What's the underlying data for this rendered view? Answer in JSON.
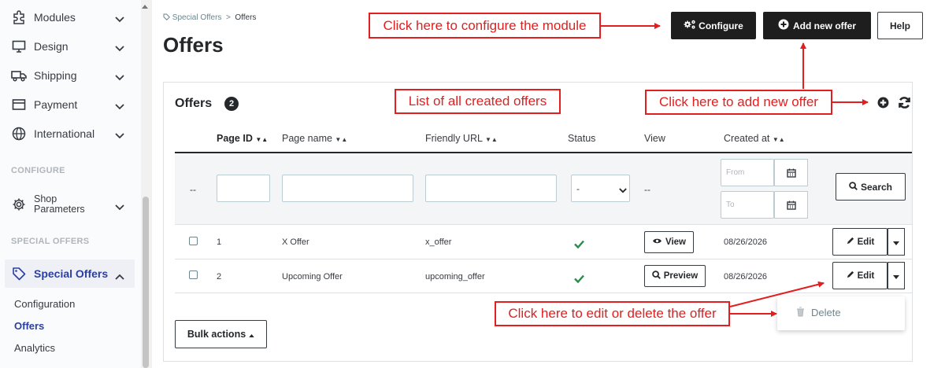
{
  "sidebar": {
    "items": [
      {
        "label": "Modules",
        "icon": "puzzle-icon"
      },
      {
        "label": "Design",
        "icon": "monitor-icon"
      },
      {
        "label": "Shipping",
        "icon": "truck-icon"
      },
      {
        "label": "Payment",
        "icon": "card-icon"
      },
      {
        "label": "International",
        "icon": "globe-icon"
      }
    ],
    "section_configure": "CONFIGURE",
    "shop_parameters_line1": "Shop",
    "shop_parameters_line2": "Parameters",
    "section_special": "SPECIAL OFFERS",
    "special_offers_label": "Special Offers",
    "sub_items": [
      "Configuration",
      "Offers",
      "Analytics"
    ]
  },
  "header": {
    "breadcrumb_parent": "Special Offers",
    "breadcrumb_sep": ">",
    "breadcrumb_current": "Offers",
    "title": "Offers",
    "configure_label": "Configure",
    "add_offer_label": "Add new offer",
    "help_label": "Help"
  },
  "card": {
    "title": "Offers",
    "count": "2",
    "columns": {
      "page_id": "Page ID",
      "page_name": "Page name",
      "friendly_url": "Friendly URL",
      "status": "Status",
      "view": "View",
      "created_at": "Created at"
    },
    "filters": {
      "dash1": "--",
      "status_select": "-",
      "dash2": "--",
      "from_placeholder": "From",
      "to_placeholder": "To",
      "search_label": "Search"
    },
    "rows": [
      {
        "id": "1",
        "name": "X Offer",
        "url": "x_offer",
        "view_label": "View",
        "date": "08/26/2026",
        "edit_label": "Edit"
      },
      {
        "id": "2",
        "name": "Upcoming Offer",
        "url": "upcoming_offer",
        "view_label": "Preview",
        "date": "08/26/2026",
        "edit_label": "Edit"
      }
    ],
    "delete_label": "Delete",
    "bulk_actions_label": "Bulk actions"
  },
  "annotations": {
    "configure": "Click here to configure the module",
    "list": "List of all created offers",
    "add": "Click here to add new offer",
    "edit": "Click here to edit or delete the offer"
  },
  "colors": {
    "annotation_red": "#e21e1e",
    "status_green": "#2d8a4e",
    "dark_button": "#1e1e1e"
  }
}
